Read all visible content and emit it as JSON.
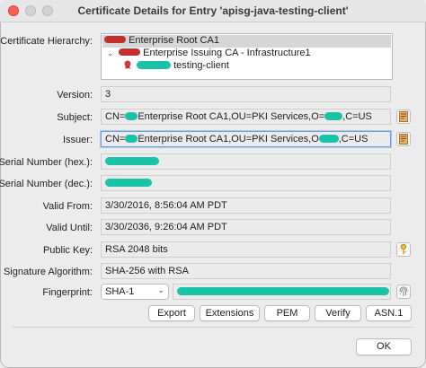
{
  "window": {
    "title": "Certificate Details for Entry 'apisg-java-testing-client'"
  },
  "hierarchy": {
    "label": "Certificate Hierarchy:",
    "items": [
      {
        "text": "Enterprise Root CA1",
        "selected": true
      },
      {
        "text": "Enterprise Issuing CA - Infrastructure1",
        "selected": false
      },
      {
        "text": "testing-client",
        "selected": false
      }
    ]
  },
  "fields": {
    "version": {
      "label": "Version:",
      "value": "3"
    },
    "subject": {
      "label": "Subject:",
      "value_before": "CN=",
      "value_mid": "Enterprise Root CA1,OU=PKI Services,O=",
      "value_after": ",C=US"
    },
    "issuer": {
      "label": "Issuer:",
      "value_before": "CN=",
      "value_mid": "Enterprise Root CA1,OU=PKI Services,O",
      "value_after": ",C=US"
    },
    "serial_hex": {
      "label": "Serial Number (hex.):"
    },
    "serial_dec": {
      "label": "Serial Number (dec.):"
    },
    "valid_from": {
      "label": "Valid From:",
      "value": "3/30/2016, 8:56:04 AM PDT"
    },
    "valid_until": {
      "label": "Valid Until:",
      "value": "3/30/2036, 9:26:04 AM PDT"
    },
    "public_key": {
      "label": "Public Key:",
      "value": "RSA 2048 bits"
    },
    "signature_algorithm": {
      "label": "Signature Algorithm:",
      "value": "SHA-256 with RSA"
    },
    "fingerprint": {
      "label": "Fingerprint:",
      "algorithm": "SHA-1"
    }
  },
  "buttons": {
    "export": "Export",
    "extensions": "Extensions",
    "pem": "PEM",
    "verify": "Verify",
    "asn1": "ASN.1",
    "ok": "OK"
  },
  "colors": {
    "redaction_teal": "#19c2a8",
    "redaction_red": "#c03030",
    "close_button": "#ff5f57",
    "focus_border": "#6aa0e0"
  }
}
